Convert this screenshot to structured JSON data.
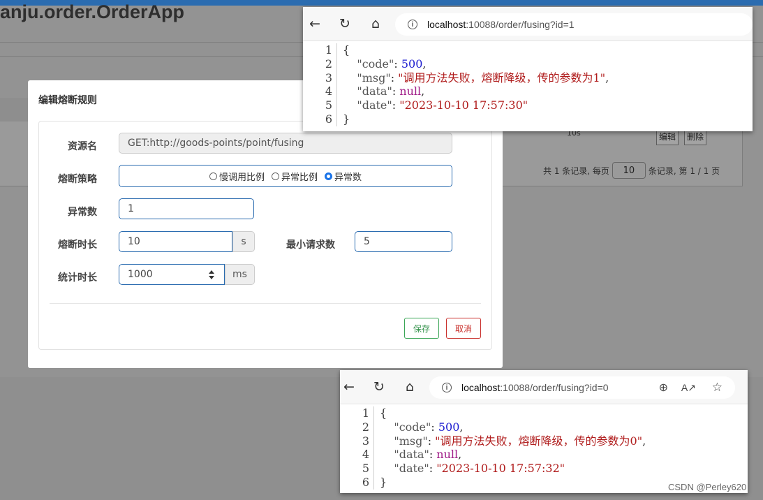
{
  "background": {
    "app_title": "anju.order.OrderApp",
    "table_cell": "10s",
    "row_buttons": [
      "编辑",
      "删除"
    ],
    "pager": {
      "prefix": "共 1 条记录, 每页",
      "page_size": "10",
      "suffix": "条记录, 第 1 / 1 页"
    }
  },
  "modal": {
    "title": "编辑熔断规则",
    "fields": {
      "resource_label": "资源名",
      "resource_value": "GET:http://goods-points/point/fusing",
      "strategy_label": "熔断策略",
      "strategy_options": [
        "慢调用比例",
        "异常比例",
        "异常数"
      ],
      "strategy_selected": "异常数",
      "exception_count_label": "异常数",
      "exception_count_value": "1",
      "duration_label": "熔断时长",
      "duration_value": "10",
      "duration_unit": "s",
      "min_request_label": "最小请求数",
      "min_request_value": "5",
      "stat_duration_label": "统计时长",
      "stat_duration_value": "1000",
      "stat_duration_unit": "ms"
    },
    "buttons": {
      "save": "保存",
      "cancel": "取消"
    }
  },
  "browser_top": {
    "url_host": "localhost",
    "url_rest": ":10088/order/fusing?id=1",
    "json": {
      "code": "500",
      "msg": "\"调用方法失败，熔断降级，传的参数为1\"",
      "data": "null",
      "date": "\"2023-10-10 17:57:30\""
    }
  },
  "browser_bottom": {
    "url_host": "localhost",
    "url_rest": ":10088/order/fusing?id=0",
    "json": {
      "code": "500",
      "msg": "\"调用方法失败，熔断降级，传的参数为0\"",
      "data": "null",
      "date": "\"2023-10-10 17:57:32\""
    }
  },
  "watermark": "CSDN @Perley620",
  "colors": {
    "accent": "#2b6cb0",
    "save": "#2e8f46",
    "cancel": "#c9302c"
  }
}
